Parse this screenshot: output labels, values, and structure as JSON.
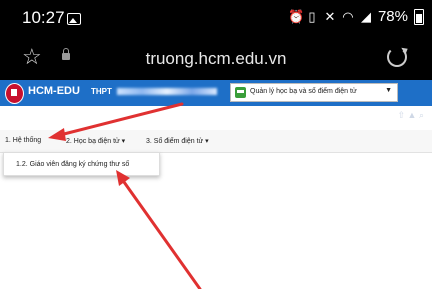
{
  "status_bar": {
    "time": "10:27",
    "battery": "78%",
    "icons": [
      "gallery-icon",
      "alarm-icon",
      "vibrate-icon",
      "mute-icon",
      "wifi-icon",
      "signal-icon",
      "battery-icon"
    ]
  },
  "browser": {
    "url": "truong.hcm.edu.vn"
  },
  "app": {
    "name": "HCM-EDU",
    "school_prefix": "THPT",
    "module_select": {
      "selected": "Quản lý học bạ và sổ điểm điện tử"
    }
  },
  "menu": {
    "items": [
      {
        "label": "1. Hệ thống"
      },
      {
        "label": "2. Học bạ điện tử"
      },
      {
        "label": "3. Sổ điểm điện tử"
      }
    ],
    "dropdown_items": [
      {
        "label": "1.2. Giáo viên đăng ký chứng thư số"
      }
    ]
  },
  "colors": {
    "header_blue": "#1e6fc7",
    "annotation_red": "#e03131"
  }
}
